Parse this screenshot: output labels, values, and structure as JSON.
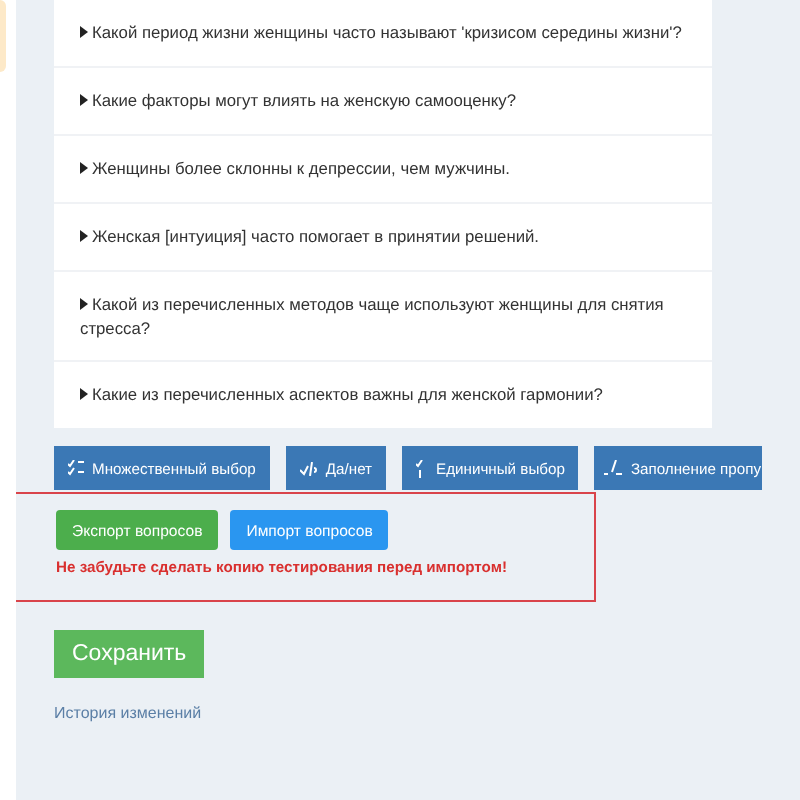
{
  "questions": [
    {
      "text": "Какой период жизни женщины часто называют 'кризисом середины жизни'?"
    },
    {
      "text": "Какие факторы могут влиять на женскую самооценку?"
    },
    {
      "text": "Женщины более склонны к депрессии, чем мужчины."
    },
    {
      "text": "Женская [интуиция] часто помогает в принятии решений."
    },
    {
      "text": "Какой из перечисленных методов чаще используют женщины для снятия стресса?"
    },
    {
      "text": "Какие из перечисленных аспектов важны для женской гармонии?"
    }
  ],
  "type_buttons": [
    {
      "label": "Множественный выбор",
      "kind": "multiple"
    },
    {
      "label": "Да/нет",
      "kind": "yesno"
    },
    {
      "label": "Единичный выбор",
      "kind": "single"
    },
    {
      "label": "Заполнение пропу",
      "kind": "fill"
    }
  ],
  "export_button": "Экспорт вопросов",
  "import_button": "Импорт вопросов",
  "warning": "Не забудьте сделать копию тестирования перед импортом!",
  "save_button": "Сохранить",
  "history_link": "История изменений"
}
